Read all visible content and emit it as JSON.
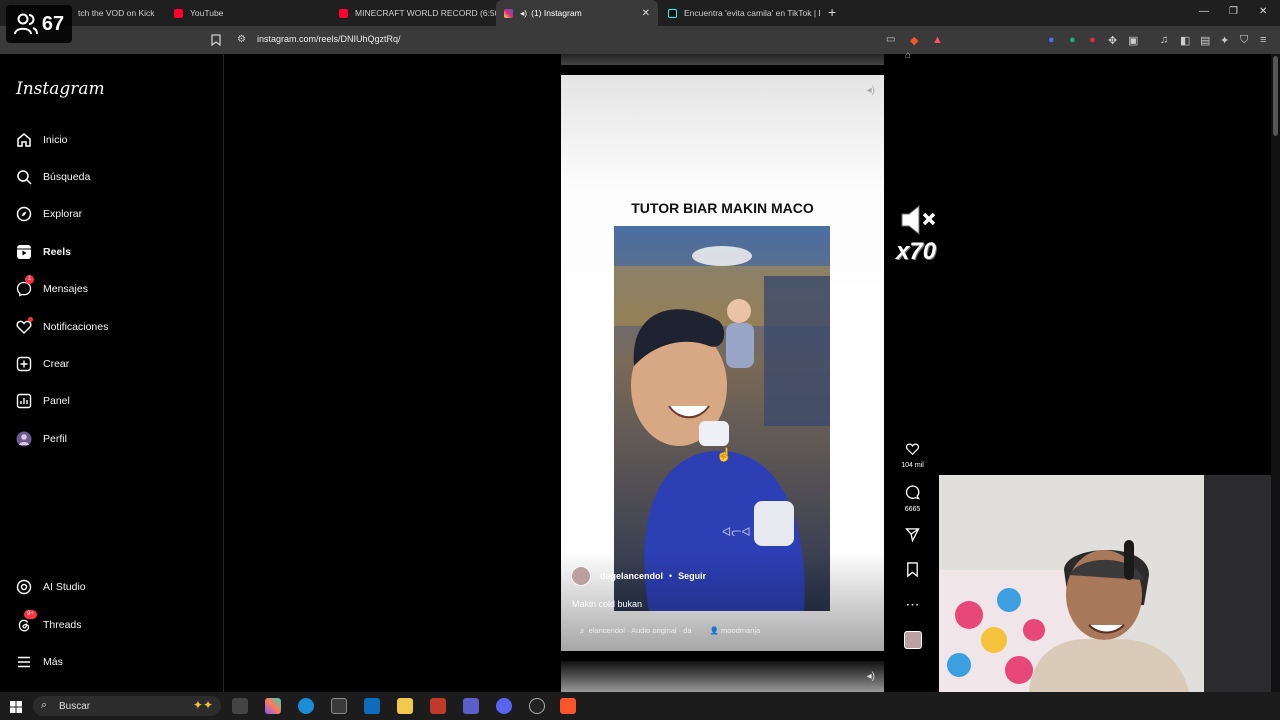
{
  "viewer": {
    "count": "67"
  },
  "tabs": [
    {
      "label": "tch the VOD on Kick",
      "favicon_color": "#53fc18"
    },
    {
      "label": "YouTube",
      "favicon_color": "#ff0033"
    },
    {
      "label": "MINECRAFT WORLD RECORD (6:50)",
      "favicon_color": "#ff0033"
    },
    {
      "label": "(1) Instagram",
      "favicon_color": "#e1306c"
    },
    {
      "label": "Encuentra 'evita camila' en TikTok | B",
      "favicon_color": "#ffffff"
    }
  ],
  "address": {
    "url": "instagram.com/reels/DNIUhQgztRq/"
  },
  "sidebar": {
    "logo": "Instagram",
    "items": [
      {
        "label": "Inicio",
        "icon": "home-icon"
      },
      {
        "label": "Búsqueda",
        "icon": "search-icon"
      },
      {
        "label": "Explorar",
        "icon": "compass-icon"
      },
      {
        "label": "Reels",
        "icon": "reels-icon"
      },
      {
        "label": "Mensajes",
        "icon": "messenger-icon",
        "badge": "1"
      },
      {
        "label": "Notificaciones",
        "icon": "heart-icon"
      },
      {
        "label": "Crear",
        "icon": "plus-square-icon"
      },
      {
        "label": "Panel",
        "icon": "chart-icon"
      },
      {
        "label": "Perfil",
        "icon": "avatar-icon"
      }
    ],
    "bottom": [
      {
        "label": "AI Studio",
        "icon": "ai-studio-icon"
      },
      {
        "label": "Threads",
        "icon": "threads-icon",
        "badge": "9+"
      },
      {
        "label": "Más",
        "icon": "menu-icon"
      }
    ]
  },
  "reel": {
    "title": "TUTOR BIAR MAKIN MACO",
    "username": "dagelancendol",
    "separator": "•",
    "follow": "Seguir",
    "caption": "Makin cold bukan",
    "audio": "elancendol · Audio original · da",
    "tagged": "moodmanja"
  },
  "actions": {
    "likes": "104 mil",
    "comments": "6665"
  },
  "overlay": {
    "label": "x70"
  },
  "taskbar": {
    "search_placeholder": "Buscar"
  },
  "colors": {
    "accent": "#ff3040",
    "chrome_bg": "#1f1f1f",
    "active_tab": "#3a3a3a"
  }
}
